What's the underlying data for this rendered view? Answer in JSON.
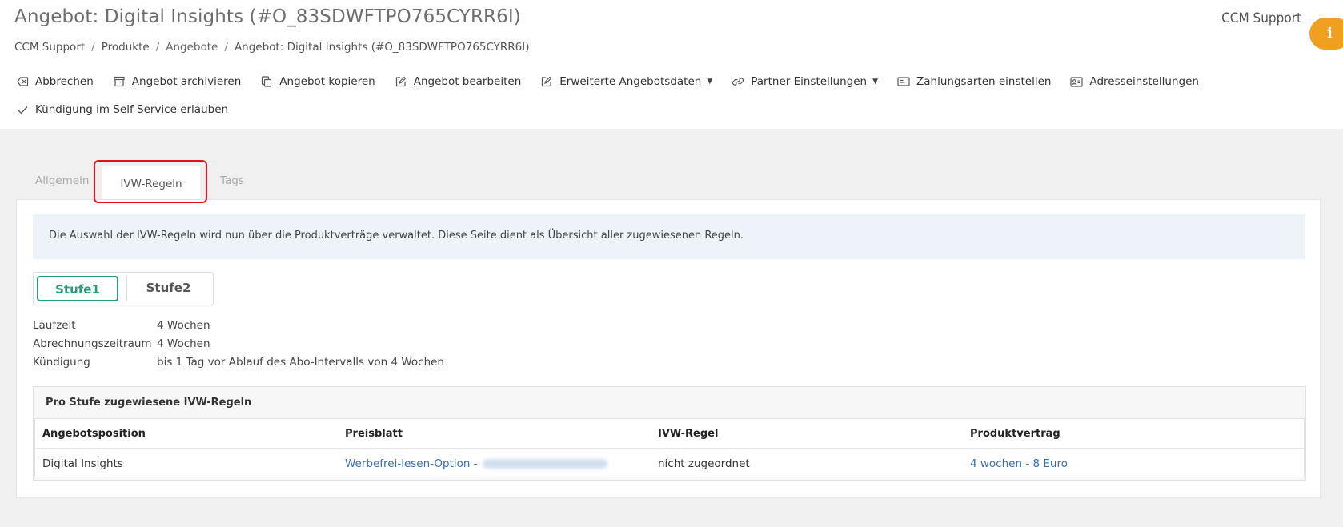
{
  "header": {
    "title": "Angebot: Digital Insights (#O_83SDWFTPO765CYRR6I)",
    "user": "CCM Support",
    "info_label": "i",
    "breadcrumb": [
      "CCM Support",
      "Produkte",
      "Angebote",
      "Angebot: Digital Insights (#O_83SDWFTPO765CYRR6I)"
    ]
  },
  "toolbar": {
    "cancel": "Abbrechen",
    "archive": "Angebot archivieren",
    "copy": "Angebot kopieren",
    "edit": "Angebot bearbeiten",
    "extended": "Erweiterte Angebotsdaten",
    "partner": "Partner Einstellungen",
    "payment": "Zahlungsarten einstellen",
    "address": "Adresseinstellungen",
    "selfservice": "Kündigung im Self Service erlauben"
  },
  "tabs": {
    "general": "Allgemein",
    "ivw": "IVW-Regeln",
    "tags": "Tags"
  },
  "notice": "Die Auswahl der IVW-Regeln wird nun über die Produktverträge verwaltet. Diese Seite dient als Übersicht aller zugewiesenen Regeln.",
  "stufen": {
    "s1": "Stufe1",
    "s2": "Stufe2"
  },
  "props": {
    "laufzeit_label": "Laufzeit",
    "laufzeit_value": "4 Wochen",
    "abrechnung_label": "Abrechnungszeitraum",
    "abrechnung_value": "4 Wochen",
    "kuendigung_label": "Kündigung",
    "kuendigung_value": "bis 1 Tag vor Ablauf des Abo-Intervalls von 4 Wochen"
  },
  "assign": {
    "title": "Pro Stufe zugewiesene IVW-Regeln",
    "columns": [
      "Angebotsposition",
      "Preisblatt",
      "IVW-Regel",
      "Produktvertrag"
    ],
    "rows": [
      {
        "position": "Digital Insights",
        "preisblatt": "Werbefrei-lesen-Option - ",
        "ivw": "nicht zugeordnet",
        "vertrag": "4 wochen - 8 Euro"
      }
    ]
  }
}
